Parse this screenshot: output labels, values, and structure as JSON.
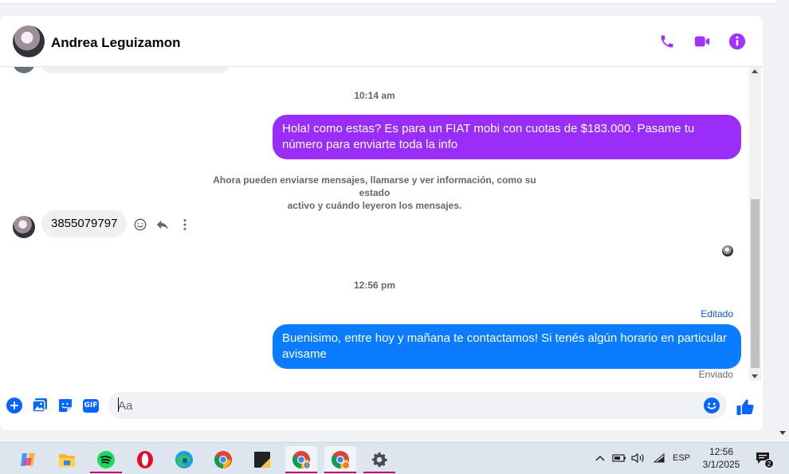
{
  "header": {
    "contact_name": "Andrea Leguizamon",
    "icons": [
      "phone-icon",
      "video-call-icon",
      "info-icon"
    ]
  },
  "colors": {
    "accent": "#a033ff",
    "outgoing_purple": "#9a2df7",
    "outgoing_blue": "#0a7cff",
    "incoming_bg": "#f0f0f0",
    "messenger_blue": "#0866ff"
  },
  "thread": {
    "timestamp_1": "10:14 am",
    "message_1": "Hola! como estas? Es para un FIAT mobi con cuotas de $183.000. Pasame tu número para enviarte toda la info",
    "info_line_1": "Ahora pueden enviarse mensajes, llamarse y ver información, como su estado",
    "info_line_2": "activo y cuándo leyeron los mensajes.",
    "incoming_message": "3855079797",
    "timestamp_2": "12:56 pm",
    "edited_label": "Editado",
    "message_2": "Buenisimo, entre hoy y mañana te contactamos! Si tenés algún horario en particular avisame",
    "status_label": "Enviado"
  },
  "composer": {
    "placeholder": "Aa",
    "gif_label": "GIF",
    "icons": [
      "add-icon",
      "image-icon",
      "sticker-icon",
      "gif-icon",
      "emoji-icon",
      "thumbs-up-icon"
    ]
  },
  "taskbar": {
    "apps": [
      "copilot",
      "file-explorer",
      "spotify",
      "opera",
      "edge",
      "chrome",
      "sticky-notes",
      "chrome-profile-1",
      "chrome-profile-2",
      "settings"
    ],
    "language": "ESP",
    "time": "12:56",
    "date": "3/1/2025",
    "notification_count": "2"
  }
}
